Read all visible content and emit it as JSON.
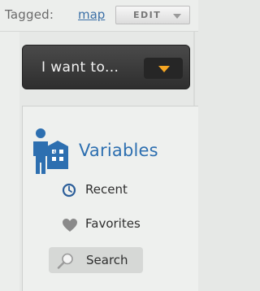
{
  "tags": {
    "label": "Tagged:",
    "value": "map",
    "edit_label": "EDIT"
  },
  "menu_button": {
    "label": "I want to..."
  },
  "variables": {
    "title": "Variables",
    "items": [
      {
        "label": "Recent",
        "icon": "clock-icon"
      },
      {
        "label": "Favorites",
        "icon": "heart-icon"
      },
      {
        "label": "Search",
        "icon": "magnifier-icon"
      }
    ]
  },
  "colors": {
    "accent_blue": "#2d6fb0",
    "dropdown_arrow": "#f6a623",
    "button_dark": "#2e2e2e"
  }
}
